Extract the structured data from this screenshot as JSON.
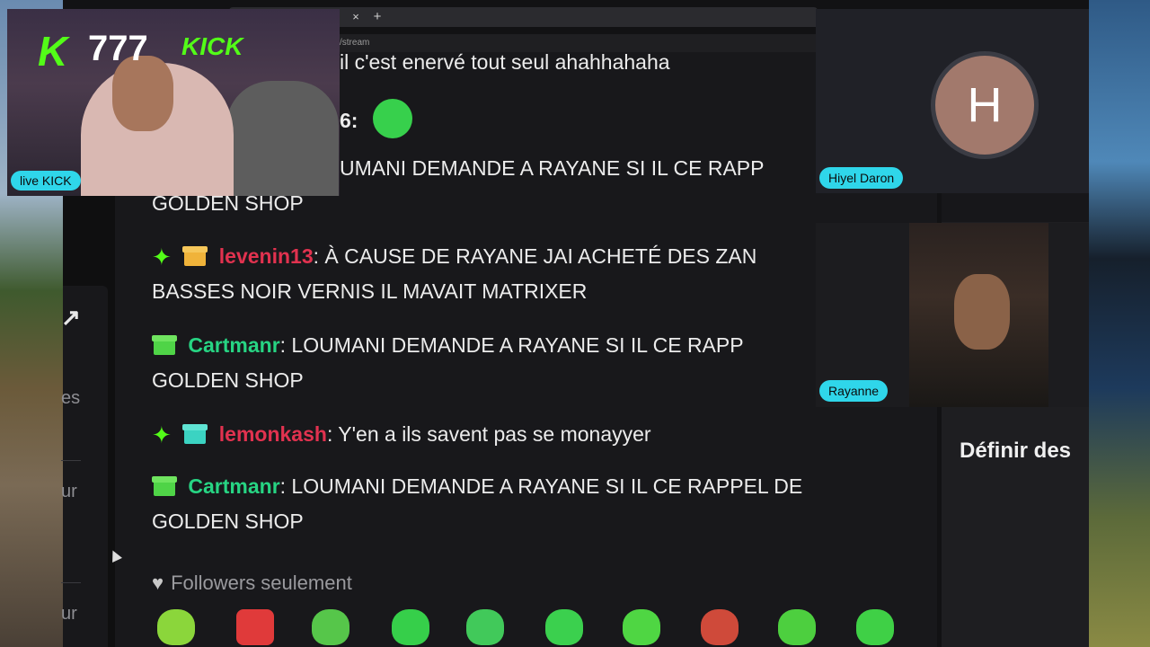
{
  "browser": {
    "tab_close": "×",
    "tab_new": "+",
    "url_fragment": "/stream"
  },
  "side_fragments": [
    "es",
    "ur",
    "ur"
  ],
  "chat": {
    "lines": [
      {
        "text": "il c'est enervé tout seul ahahhahaha"
      },
      {
        "text": "6:"
      },
      {
        "text": "UMANI DEMANDE A RAYANE SI IL CE RAPP"
      },
      {
        "text": "GOLDEN SHOP"
      }
    ],
    "messages": [
      {
        "user": "levenin13",
        "text": ": À CAUSE DE RAYANE JAI ACHETÉ DES ZAN",
        "text2": "BASSES NOIR VERNIS IL MAVAIT MATRIXER",
        "user_color": "#e1324f"
      },
      {
        "user": "Cartmanr",
        "text": ": LOUMANI DEMANDE A RAYANE SI IL CE RAPP",
        "text2": "GOLDEN SHOP",
        "user_color": "#27d483"
      },
      {
        "user": "lemonkash",
        "text": ": Y'en a ils savent pas se monayyer",
        "user_color": "#e1324f"
      },
      {
        "user": "Cartmanr",
        "text": ": LOUMANI DEMANDE A RAYANE SI IL CE RAPPEL DE",
        "text2": "GOLDEN SHOP",
        "user_color": "#27d483"
      }
    ],
    "followers_mode": "Followers seulement",
    "emotes": [
      "halo-emote",
      "angry-emote",
      "zombie-emote",
      "cool-emote",
      "skull-emote",
      "grin-emote",
      "happy-emote",
      "clown-emote",
      "cheeky-emote",
      "love-emote"
    ]
  },
  "stream": {
    "overlay_kick": "K",
    "overlay_number": "777",
    "overlay_brand": "KICK",
    "live_badge": "live KICK"
  },
  "call": {
    "avatar_initial": "H",
    "participant1": "Hiyel Daron",
    "participant2": "Rayanne",
    "side_heading": "Définir des"
  },
  "colors": {
    "kick_green": "#53fc18",
    "badge_cyan": "#2fd6ea",
    "user_red": "#e1324f",
    "user_green": "#27d483"
  }
}
